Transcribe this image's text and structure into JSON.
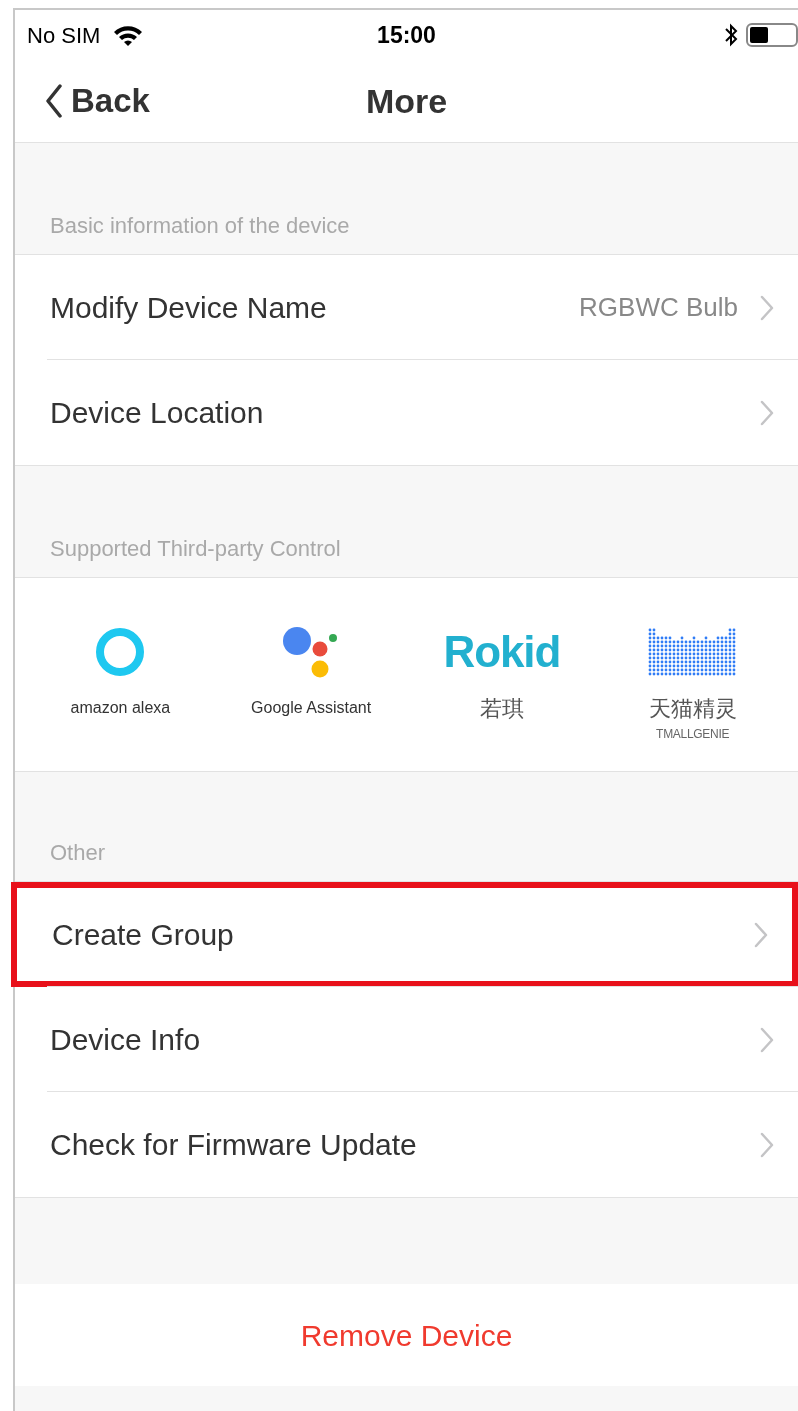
{
  "status_bar": {
    "carrier": "No SIM",
    "time": "15:00"
  },
  "nav": {
    "back": "Back",
    "title": "More"
  },
  "sections": [
    {
      "header": "Basic information of the device",
      "kind": "rows",
      "rows": [
        {
          "label": "Modify Device Name",
          "value": "RGBWC Bulb",
          "highlighted": false
        },
        {
          "label": "Device Location",
          "highlighted": false
        }
      ]
    },
    {
      "header": "Supported Third-party Control",
      "kind": "partners",
      "partners": [
        {
          "kind": "alexa",
          "label": "amazon alexa"
        },
        {
          "kind": "google",
          "label": "Google Assistant"
        },
        {
          "kind": "rokid",
          "logo_text": "Rokid",
          "label": "若琪"
        },
        {
          "kind": "tmall",
          "label": "天猫精灵",
          "sublabel": "TMALLGENIE"
        }
      ]
    },
    {
      "header": "Other",
      "kind": "rows",
      "rows": [
        {
          "label": "Create Group",
          "highlighted": true
        },
        {
          "label": "Device Info",
          "highlighted": false
        },
        {
          "label": "Check for Firmware Update",
          "highlighted": false
        }
      ]
    }
  ],
  "remove_button": "Remove Device"
}
